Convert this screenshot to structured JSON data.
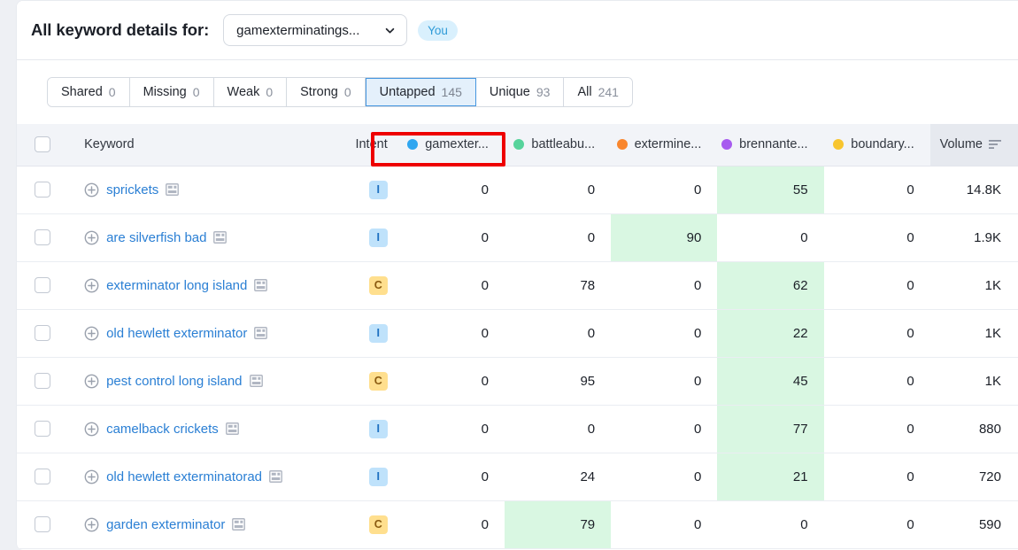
{
  "header": {
    "title": "All keyword details for:",
    "domain_selector": {
      "value": "gamexterminatings...",
      "icon": "chevron-down-icon"
    },
    "you_badge": "You"
  },
  "tabs": [
    {
      "label": "Shared",
      "count": "0",
      "selected": false
    },
    {
      "label": "Missing",
      "count": "0",
      "selected": false
    },
    {
      "label": "Weak",
      "count": "0",
      "selected": false
    },
    {
      "label": "Strong",
      "count": "0",
      "selected": false
    },
    {
      "label": "Untapped",
      "count": "145",
      "selected": true
    },
    {
      "label": "Unique",
      "count": "93",
      "selected": false
    },
    {
      "label": "All",
      "count": "241",
      "selected": false
    }
  ],
  "annotation": {
    "target_tab": "Untapped",
    "color": "#ee0000"
  },
  "table": {
    "columns": [
      {
        "key": "keyword",
        "label": "Keyword",
        "dot": null
      },
      {
        "key": "intent",
        "label": "Intent",
        "dot": null
      },
      {
        "key": "c1",
        "label": "gamexter...",
        "dot": "#2fa6f0"
      },
      {
        "key": "c2",
        "label": "battleabu...",
        "dot": "#56d39b"
      },
      {
        "key": "c3",
        "label": "extermine...",
        "dot": "#f9862d"
      },
      {
        "key": "c4",
        "label": "brennante...",
        "dot": "#a75bef"
      },
      {
        "key": "c5",
        "label": "boundary...",
        "dot": "#f8c52e"
      },
      {
        "key": "volume",
        "label": "Volume",
        "dot": null,
        "sort_icon": "sort-descending-icon",
        "sorted": true
      }
    ],
    "rows": [
      {
        "keyword": "sprickets",
        "intent": "I",
        "c1": "0",
        "c2": "0",
        "c3": "0",
        "c4": "55",
        "c5": "0",
        "volume": "14.8K",
        "hl": "c4"
      },
      {
        "keyword": "are silverfish bad",
        "intent": "I",
        "c1": "0",
        "c2": "0",
        "c3": "90",
        "c4": "0",
        "c5": "0",
        "volume": "1.9K",
        "hl": "c3"
      },
      {
        "keyword": "exterminator long island",
        "intent": "C",
        "c1": "0",
        "c2": "78",
        "c3": "0",
        "c4": "62",
        "c5": "0",
        "volume": "1K",
        "hl": "c4"
      },
      {
        "keyword": "old hewlett exterminator",
        "intent": "I",
        "c1": "0",
        "c2": "0",
        "c3": "0",
        "c4": "22",
        "c5": "0",
        "volume": "1K",
        "hl": "c4"
      },
      {
        "keyword": "pest control long island",
        "intent": "C",
        "c1": "0",
        "c2": "95",
        "c3": "0",
        "c4": "45",
        "c5": "0",
        "volume": "1K",
        "hl": "c4"
      },
      {
        "keyword": "camelback crickets",
        "intent": "I",
        "c1": "0",
        "c2": "0",
        "c3": "0",
        "c4": "77",
        "c5": "0",
        "volume": "880",
        "hl": "c4"
      },
      {
        "keyword": "old hewlett exterminatorad",
        "intent": "I",
        "c1": "0",
        "c2": "24",
        "c3": "0",
        "c4": "21",
        "c5": "0",
        "volume": "720",
        "hl": "c4"
      },
      {
        "keyword": "garden exterminator",
        "intent": "C",
        "c1": "0",
        "c2": "79",
        "c3": "0",
        "c4": "0",
        "c5": "0",
        "volume": "590",
        "hl": "c2"
      }
    ],
    "row_icons": {
      "expand": "plus-circle-icon",
      "serp": "serp-features-icon",
      "checkbox": "row-checkbox"
    }
  },
  "colors": {
    "highlight_cell": "#d9f7e2",
    "tab_selected_bg": "#e4f0fb",
    "tab_selected_border": "#4596e0",
    "link": "#2a7fd4"
  }
}
